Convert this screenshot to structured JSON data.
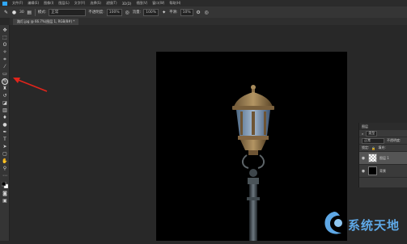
{
  "menubar": {
    "items": [
      "文件(F)",
      "编辑(E)",
      "图像(I)",
      "图层(L)",
      "文字(Y)",
      "选择(S)",
      "滤镜(T)",
      "3D(D)",
      "视图(V)",
      "窗口(W)",
      "帮助(H)"
    ]
  },
  "options": {
    "brush_size": "30",
    "mode_label": "模式:",
    "mode_value": "正常",
    "opacity_label": "不透明度:",
    "opacity_value": "100%",
    "flow_label": "流量:",
    "flow_value": "100%",
    "smooth_label": "平滑:",
    "smooth_value": "10%"
  },
  "document_tab": {
    "title": "路灯.jpg @ 66.7%(图层 1, RGB/8#) *"
  },
  "layers_panel": {
    "title": "图层",
    "kind_label": "类型",
    "blend_value": "正常",
    "opacity_label": "不透明度:",
    "lock_label": "锁定:",
    "fill_label": "填充:",
    "layers": [
      {
        "name": "图层 1",
        "selected": true
      },
      {
        "name": "背景",
        "selected": false
      }
    ]
  },
  "watermark": {
    "text": "系统天地"
  },
  "colors": {
    "accent": "#31a8ff",
    "annotation": "#e0241b",
    "canvas": "#000000",
    "watermark": "#5ea8e6"
  }
}
